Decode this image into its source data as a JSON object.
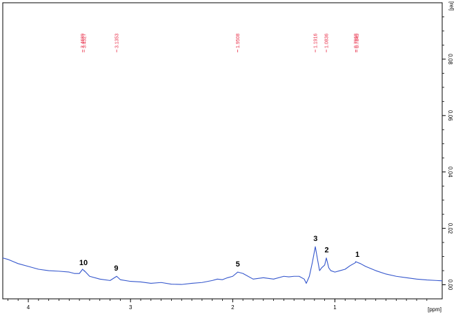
{
  "chart_data": {
    "type": "line",
    "title": "",
    "xlabel": "[ppm]",
    "ylabel": "[rel]",
    "x_reversed": true,
    "xlim": [
      4.25,
      -0.05
    ],
    "ylim": [
      -0.005,
      0.1
    ],
    "x_ticks": [
      "4",
      "3",
      "2",
      "1"
    ],
    "y_ticks": [
      "0.00",
      "0.02",
      "0.04",
      "0.06",
      "0.08"
    ],
    "line_color": "#3355cc",
    "series": [
      {
        "x": [
          4.25,
          4.2,
          4.1,
          4.0,
          3.9,
          3.8,
          3.7,
          3.6,
          3.55,
          3.5,
          3.4689,
          3.45,
          3.4527,
          3.4,
          3.3,
          3.2,
          3.1353,
          3.1,
          3.0,
          2.9,
          2.8,
          2.7,
          2.6,
          2.5,
          2.4,
          2.3,
          2.2,
          2.15,
          2.1,
          2.05,
          2.0,
          1.95,
          1.9,
          1.8,
          1.7,
          1.6,
          1.5,
          1.45,
          1.4,
          1.35,
          1.3,
          1.28,
          1.25,
          1.22,
          1.1916,
          1.17,
          1.15,
          1.13,
          1.1,
          1.0836,
          1.06,
          1.04,
          1.0,
          0.95,
          0.9,
          0.85,
          0.8,
          0.7968,
          0.7849,
          0.75,
          0.7,
          0.6,
          0.5,
          0.4,
          0.3,
          0.2,
          0.1,
          0.0,
          -0.05
        ],
        "y": [
          0.0095,
          0.009,
          0.0075,
          0.0065,
          0.0055,
          0.005,
          0.0048,
          0.0045,
          0.004,
          0.004,
          0.0055,
          0.0048,
          0.005,
          0.003,
          0.002,
          0.0015,
          0.003,
          0.0018,
          0.0012,
          0.001,
          0.0005,
          0.0008,
          0.0002,
          0.0001,
          0.0005,
          0.0008,
          0.0015,
          0.002,
          0.0018,
          0.0025,
          0.003,
          0.0045,
          0.004,
          0.002,
          0.0025,
          0.002,
          0.003,
          0.0028,
          0.003,
          0.003,
          0.002,
          0.0005,
          0.003,
          0.008,
          0.0135,
          0.009,
          0.005,
          0.006,
          0.007,
          0.0095,
          0.006,
          0.005,
          0.0045,
          0.005,
          0.0055,
          0.0068,
          0.0078,
          0.0082,
          0.008,
          0.0075,
          0.0065,
          0.005,
          0.0038,
          0.003,
          0.0025,
          0.002,
          0.0017,
          0.0015,
          0.0014
        ]
      }
    ],
    "peak_labels": [
      {
        "text": "3.4689",
        "ppm": 3.4689
      },
      {
        "text": "3.4527",
        "ppm": 3.4527
      },
      {
        "text": "3.1353",
        "ppm": 3.1353
      },
      {
        "text": "1.9508",
        "ppm": 1.9508
      },
      {
        "text": "1.1916",
        "ppm": 1.1916
      },
      {
        "text": "1.0836",
        "ppm": 1.0836
      },
      {
        "text": "0.7968",
        "ppm": 0.7968
      },
      {
        "text": "0.7849",
        "ppm": 0.7849
      }
    ],
    "peak_numbers": [
      {
        "text": "10",
        "ppm": 3.46
      },
      {
        "text": "9",
        "ppm": 3.14
      },
      {
        "text": "5",
        "ppm": 1.95
      },
      {
        "text": "3",
        "ppm": 1.19
      },
      {
        "text": "2",
        "ppm": 1.08
      },
      {
        "text": "1",
        "ppm": 0.78
      }
    ]
  }
}
